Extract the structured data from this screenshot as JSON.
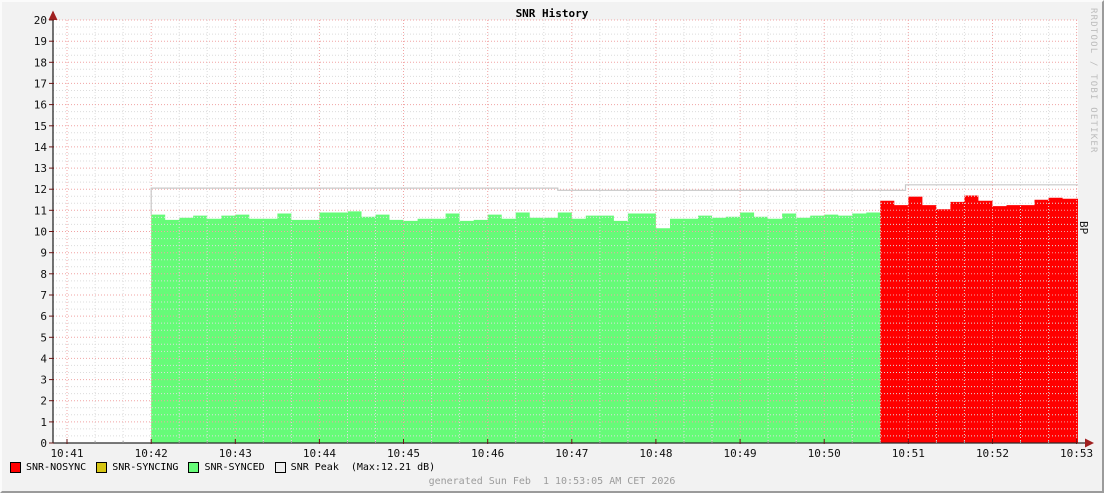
{
  "title": "SNR History",
  "watermark": "RRDTOOL / TOBI OETIKER",
  "vertical_label": "BP",
  "footer": "generated Sun Feb  1 10:53:05 AM CET 2026",
  "max_note": "(Max:12.21 dB)",
  "legend": [
    {
      "label": "SNR-NOSYNC",
      "color": "#ff0000"
    },
    {
      "label": "SNR-SYNCING",
      "color": "#d6c513"
    },
    {
      "label": "SNR-SYNCED",
      "color": "#66fb78"
    },
    {
      "label": "SNR Peak",
      "color": "#ededed"
    }
  ],
  "colors": {
    "background": "#f2f2f2",
    "plot_bg": "#ffffff",
    "major_grid": "#f1a4a4",
    "minor_grid": "#dcdcdc",
    "axis": "#2b2b2b",
    "arrow": "#a02020",
    "tick": "#6b1515",
    "synced_green": "#66fb78",
    "nosync_red": "#ff0000",
    "syncing_yellow": "#d6c513",
    "peak_line": "#c8c8c8",
    "label_text": "#111111"
  },
  "chart_data": {
    "type": "area",
    "title": "SNR History",
    "ylabel_right": "BP",
    "ylim": [
      0,
      20
    ],
    "y_tick_step": 1,
    "x_tick_labels": [
      "10:41",
      "10:42",
      "10:43",
      "10:44",
      "10:45",
      "10:46",
      "10:47",
      "10:48",
      "10:49",
      "10:50",
      "10:51",
      "10:52",
      "10:53"
    ],
    "x_tick_interval_seconds": 60,
    "x_window_seconds": [
      -10,
      721
    ],
    "grid": "major red dotted, minor gray dotted (1/3 intervals)",
    "legend_position": "bottom-left",
    "peak_max_db": 12.21,
    "series": [
      {
        "name": "SNR-SYNCED",
        "render": "step-area",
        "color": "#66fb78",
        "start_seconds": 60,
        "step_seconds": 10,
        "values": [
          10.8,
          10.55,
          10.65,
          10.75,
          10.6,
          10.75,
          10.8,
          10.6,
          10.6,
          10.85,
          10.55,
          10.55,
          10.9,
          10.9,
          10.95,
          10.7,
          10.8,
          10.55,
          10.5,
          10.6,
          10.6,
          10.85,
          10.5,
          10.55,
          10.8,
          10.6,
          10.9,
          10.65,
          10.65,
          10.9,
          10.6,
          10.75,
          10.75,
          10.5,
          10.85,
          10.85,
          10.15,
          10.6,
          10.6,
          10.75,
          10.65,
          10.7,
          10.9,
          10.7,
          10.6,
          10.85,
          10.65,
          10.75,
          10.8,
          10.75,
          10.85,
          10.9
        ]
      },
      {
        "name": "SNR-NOSYNC",
        "render": "step-area",
        "color": "#ff0000",
        "start_seconds": 580,
        "step_seconds": 10,
        "extend_to_seconds": 721,
        "values": [
          11.45,
          11.25,
          11.65,
          11.25,
          11.05,
          11.4,
          11.7,
          11.45,
          11.2,
          11.25,
          11.25,
          11.5,
          11.6,
          11.55
        ]
      },
      {
        "name": "SNR-SYNCING",
        "render": "step-area",
        "color": "#d6c513",
        "values": []
      },
      {
        "name": "SNR Peak",
        "render": "step-line",
        "color": "#c8c8c8",
        "segments": [
          {
            "from_seconds": 60,
            "to_seconds": 350,
            "value": 12.05
          },
          {
            "from_seconds": 350,
            "to_seconds": 598,
            "value": 11.95
          },
          {
            "from_seconds": 598,
            "to_seconds": 721,
            "value": 12.21
          }
        ]
      }
    ]
  }
}
